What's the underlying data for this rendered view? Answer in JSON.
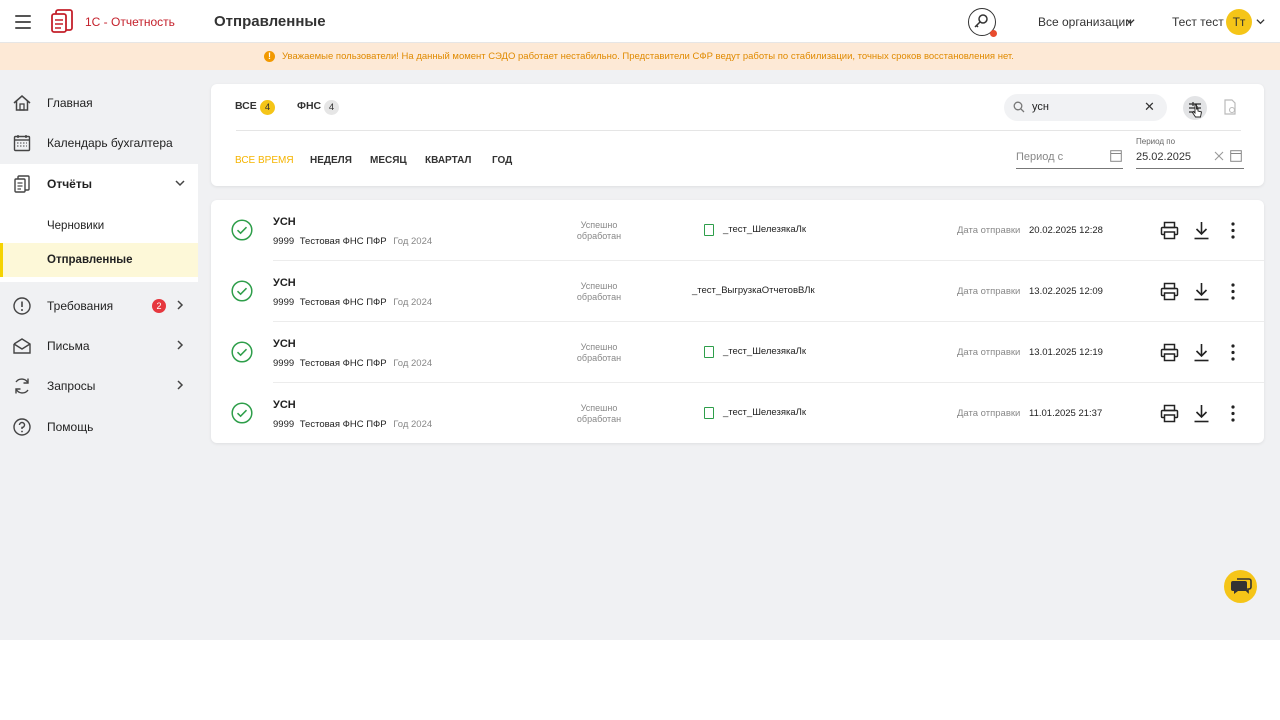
{
  "header": {
    "brand": "1С - Отчетность",
    "page_title": "Отправленные",
    "org_select": "Все организации",
    "user_name": "Тест тест",
    "avatar_initials": "Тт"
  },
  "notice": {
    "text": "Уважаемые пользователи! На данный момент СЭДО работает нестабильно. Представители СФР ведут работы по стабилизации, точных сроков восстановления нет.",
    "color": "#f29900"
  },
  "sidebar": {
    "items": [
      {
        "label": "Главная",
        "icon": "home-icon"
      },
      {
        "label": "Календарь бухгалтера",
        "icon": "calendar-icon"
      },
      {
        "label": "Отчёты",
        "icon": "reports-icon"
      },
      {
        "label": "Требования",
        "icon": "alert-icon",
        "badge": "2"
      },
      {
        "label": "Письма",
        "icon": "mail-icon"
      },
      {
        "label": "Запросы",
        "icon": "refresh-icon"
      },
      {
        "label": "Помощь",
        "icon": "help-icon"
      }
    ],
    "sub_items": [
      {
        "label": "Черновики"
      },
      {
        "label": "Отправленные",
        "active": true
      }
    ]
  },
  "filters": {
    "tabs": [
      {
        "label": "ВСЕ",
        "count": "4"
      },
      {
        "label": "ФНС",
        "count": "4"
      }
    ],
    "periods": [
      "ВСЕ ВРЕМЯ",
      "НЕДЕЛЯ",
      "МЕСЯЦ",
      "КВАРТАЛ",
      "ГОД"
    ],
    "search_value": "усн",
    "date_from_placeholder": "Период с",
    "date_to_label": "Период по",
    "date_to_value": "25.02.2025"
  },
  "rows": [
    {
      "title": "УСН",
      "code": "9999",
      "org": "Тестовая ФНС ПФР",
      "year": "Год 2024",
      "status": [
        "Успешно",
        "обработан"
      ],
      "file": "_тест_ШелезякаЛк",
      "file_icon": true,
      "date_label": "Дата отправки",
      "date": "20.02.2025 12:28"
    },
    {
      "title": "УСН",
      "code": "9999",
      "org": "Тестовая ФНС ПФР",
      "year": "Год 2024",
      "status": [
        "Успешно",
        "обработан"
      ],
      "file": "_тест_ВыгрузкаОтчетовВЛк",
      "file_icon": false,
      "date_label": "Дата отправки",
      "date": "13.02.2025 12:09"
    },
    {
      "title": "УСН",
      "code": "9999",
      "org": "Тестовая ФНС ПФР",
      "year": "Год 2024",
      "status": [
        "Успешно",
        "обработан"
      ],
      "file": "_тест_ШелезякаЛк",
      "file_icon": true,
      "date_label": "Дата отправки",
      "date": "13.01.2025 12:19"
    },
    {
      "title": "УСН",
      "code": "9999",
      "org": "Тестовая ФНС ПФР",
      "year": "Год 2024",
      "status": [
        "Успешно",
        "обработан"
      ],
      "file": "_тест_ШелезякаЛк",
      "file_icon": true,
      "date_label": "Дата отправки",
      "date": "11.01.2025 21:37"
    }
  ],
  "colors": {
    "accent": "#f5c518",
    "brand": "#c4202b",
    "success": "#2e9e4a",
    "badge": "#e6373e"
  }
}
